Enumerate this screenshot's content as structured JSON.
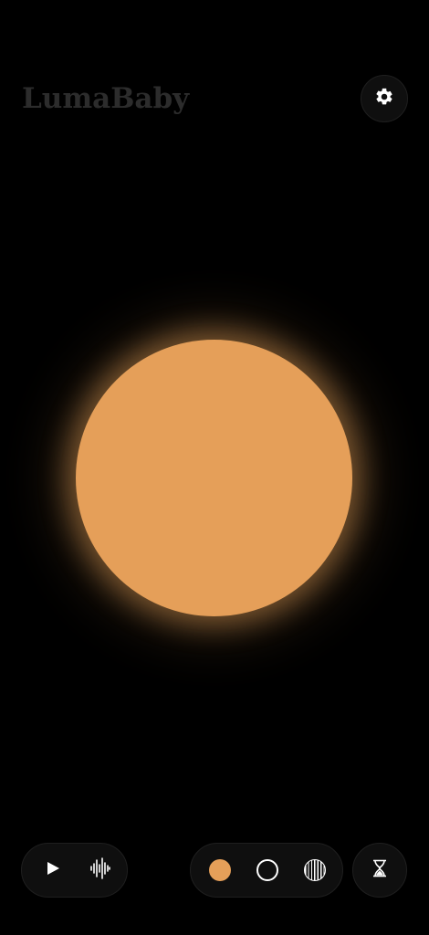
{
  "app": {
    "title": "LumaBaby"
  },
  "header": {
    "settings_icon": "gear-icon"
  },
  "light": {
    "color": "#e59f59"
  },
  "controls": {
    "playback": {
      "play_icon": "play-icon",
      "sound_icon": "waveform-icon"
    },
    "light_modes": [
      {
        "icon": "solid-circle-icon",
        "color": "#e59f59"
      },
      {
        "icon": "ring-circle-icon",
        "color": "#ffffff"
      },
      {
        "icon": "striped-circle-icon",
        "color": "#ffffff"
      }
    ],
    "timer_icon": "hourglass-icon"
  }
}
